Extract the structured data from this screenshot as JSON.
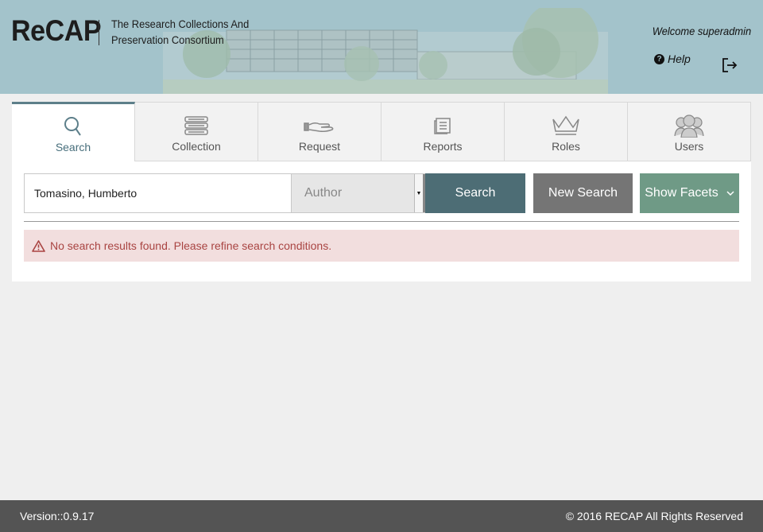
{
  "header": {
    "logo": "ReCAP",
    "tagline_line1": "The Research Collections And",
    "tagline_line2": "Preservation Consortium",
    "welcome": "Welcome superadmin",
    "help": "Help"
  },
  "tabs": [
    {
      "label": "Search",
      "icon": "search-icon",
      "active": true
    },
    {
      "label": "Collection",
      "icon": "books-icon"
    },
    {
      "label": "Request",
      "icon": "hand-icon"
    },
    {
      "label": "Reports",
      "icon": "document-icon"
    },
    {
      "label": "Roles",
      "icon": "crown-icon"
    },
    {
      "label": "Users",
      "icon": "users-icon"
    }
  ],
  "search": {
    "value": "Tomasino, Humberto",
    "field": "Author",
    "search_button": "Search",
    "new_search_button": "New Search",
    "facets_button": "Show Facets"
  },
  "alert": {
    "message": "No search results found. Please refine search conditions."
  },
  "footer": {
    "version": "Version::0.9.17",
    "copyright": "© 2016 RECAP All Rights Reserved"
  },
  "colors": {
    "header_bg": "#a3c3cb",
    "search_btn": "#4d6d75",
    "new_search_btn": "#757575",
    "facets_btn": "#6f9a86",
    "alert_bg": "#f2dede",
    "alert_text": "#a94442",
    "footer_bg": "#545454"
  }
}
